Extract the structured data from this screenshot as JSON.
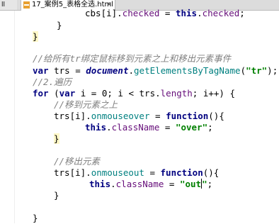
{
  "tabs": {
    "left_partial": "ll",
    "active_label": "17_案例5_表格全选.html",
    "close_glyph": "×"
  },
  "code": {
    "l0_obj": "cbs[i].",
    "l0_prop": "checked",
    "l0_eq": " = ",
    "l0_this": "this",
    "l0_dot": ".",
    "l0_prop2": "checked",
    "l0_semi": ";",
    "l1_brace": "}",
    "l2_brace": "}",
    "c1": "//给所有tr绑定鼠标移到元素之上和移出元素事件",
    "l4_var": "var",
    "l4_name": " trs = ",
    "l4_doc": "document",
    "l4_dot": ".",
    "l4_method": "getElementsByTagName",
    "l4_open": "(",
    "l4_str": "\"tr\"",
    "l4_close": ");",
    "c2": "//2.遍历",
    "l6_for": "for",
    "l6_a": " (",
    "l6_var": "var",
    "l6_b": " i = 0; i < trs.",
    "l6_len": "length",
    "l6_c": "; i++) {",
    "c3": "//移到元素之上",
    "l8_a": "trs[i].",
    "l8_ev": "onmouseover",
    "l8_b": " = ",
    "l8_fn": "function",
    "l8_c": "(){",
    "l9_this": "this",
    "l9_dot": ".",
    "l9_cls": "className",
    "l9_eq": " = ",
    "l9_str": "\"over\"",
    "l9_semi": ";",
    "l10_brace": "}",
    "c4": "//移出元素",
    "l12_a": "trs[i].",
    "l12_ev": "onmouseout",
    "l12_b": " = ",
    "l12_fn": "function",
    "l12_c": "(){",
    "l13_this": "this",
    "l13_dot": ".",
    "l13_cls": "className",
    "l13_eq": " = ",
    "l13_str1": "\"out",
    "l13_str2": "\"",
    "l13_semi": ";",
    "l14_brace": "}",
    "l16_brace": "}"
  }
}
